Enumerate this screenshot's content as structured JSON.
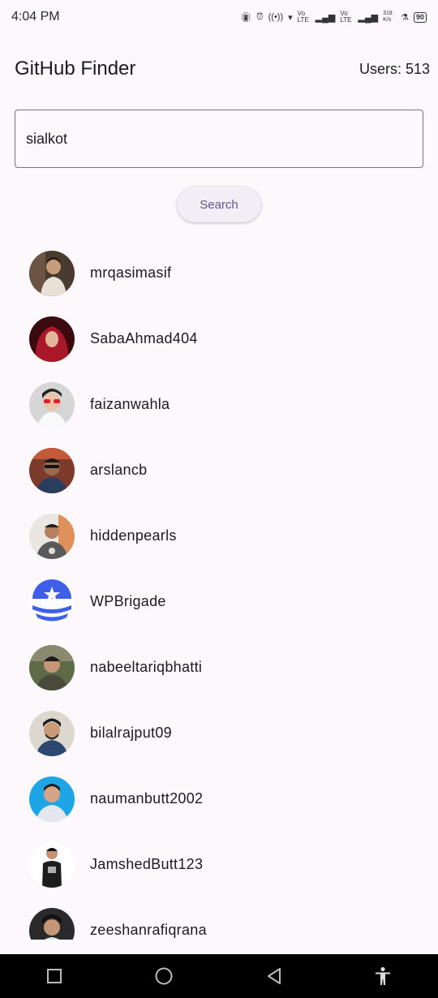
{
  "status_bar": {
    "time": "4:04 PM",
    "network_1": "Vo LTE",
    "network_2": "Vo LTE",
    "speed": "318 K/s",
    "battery": "90"
  },
  "app_bar": {
    "title": "GitHub Finder",
    "user_count": "Users: 513"
  },
  "search": {
    "value": "sialkot",
    "button_label": "Search"
  },
  "users": [
    {
      "login": "mrqasimasif",
      "avatar_bg": "#4a3b30"
    },
    {
      "login": "SabaAhmad404",
      "avatar_bg": "#7a1520"
    },
    {
      "login": "faizanwahla",
      "avatar_bg": "#c9c9c9"
    },
    {
      "login": "arslancb",
      "avatar_bg": "#8a3a2a"
    },
    {
      "login": "hiddenpearls",
      "avatar_bg": "#d9cfc4"
    },
    {
      "login": "WPBrigade",
      "avatar_bg": "#ffffff"
    },
    {
      "login": "nabeeltariqbhatti",
      "avatar_bg": "#4d5a3a"
    },
    {
      "login": "bilalrajput09",
      "avatar_bg": "#d8d2c8"
    },
    {
      "login": "naumanbutt2002",
      "avatar_bg": "#1ea5e6"
    },
    {
      "login": "JamshedButt123",
      "avatar_bg": "#ffffff"
    },
    {
      "login": "zeeshanrafiqrana",
      "avatar_bg": "#2a2a2a"
    }
  ],
  "colors": {
    "background": "#fcf8fc",
    "accent": "#65558f",
    "brand_blue": "#3f5fe8"
  }
}
